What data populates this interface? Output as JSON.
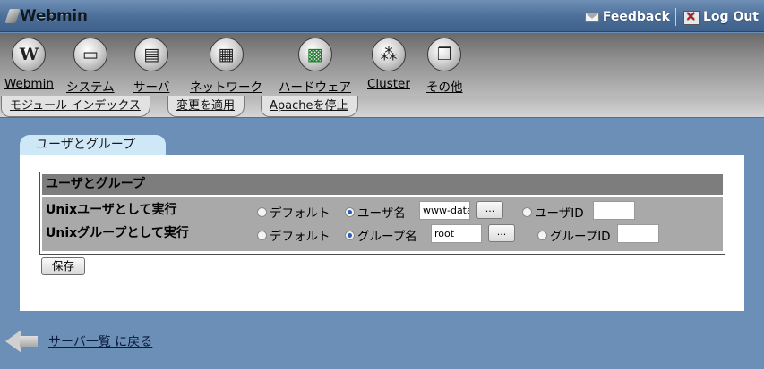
{
  "app": {
    "title": "Webmin",
    "feedback_label": "Feedback",
    "logout_label": "Log Out"
  },
  "categories": [
    {
      "label": "Webmin",
      "icon": "webmin-logo-icon"
    },
    {
      "label": "システム",
      "icon": "computer-icon"
    },
    {
      "label": "サーバ",
      "icon": "server-icon"
    },
    {
      "label": "ネットワーク",
      "icon": "network-icon"
    },
    {
      "label": "ハードウェア",
      "icon": "circuit-board-icon"
    },
    {
      "label": "Cluster",
      "icon": "cluster-icon"
    },
    {
      "label": "その他",
      "icon": "windows-icon"
    }
  ],
  "module_tabs": [
    {
      "label": "モジュール インデックス"
    },
    {
      "label": "変更を適用"
    },
    {
      "label": "Apacheを停止"
    }
  ],
  "section_tab": "ユーザとグループ",
  "form": {
    "header": "ユーザとグループ",
    "user_row": {
      "label": "Unixユーザとして実行",
      "opt_default": "デフォルト",
      "opt_name": "ユーザ名",
      "name_value": "www-data",
      "opt_id": "ユーザID",
      "id_value": "",
      "selected": "name"
    },
    "group_row": {
      "label": "Unixグループとして実行",
      "opt_default": "デフォルト",
      "opt_name": "グループ名",
      "name_value": "root",
      "opt_id": "グループID",
      "id_value": "",
      "selected": "name"
    },
    "browse_label": "...",
    "save_label": "保存"
  },
  "return_link": "サーバ一覧 に戻る",
  "colors": {
    "page_bg": "#6b8fb6",
    "section_tab": "#cfe8f8",
    "form_header": "#7d7d7d",
    "form_body": "#a9a9a9"
  }
}
